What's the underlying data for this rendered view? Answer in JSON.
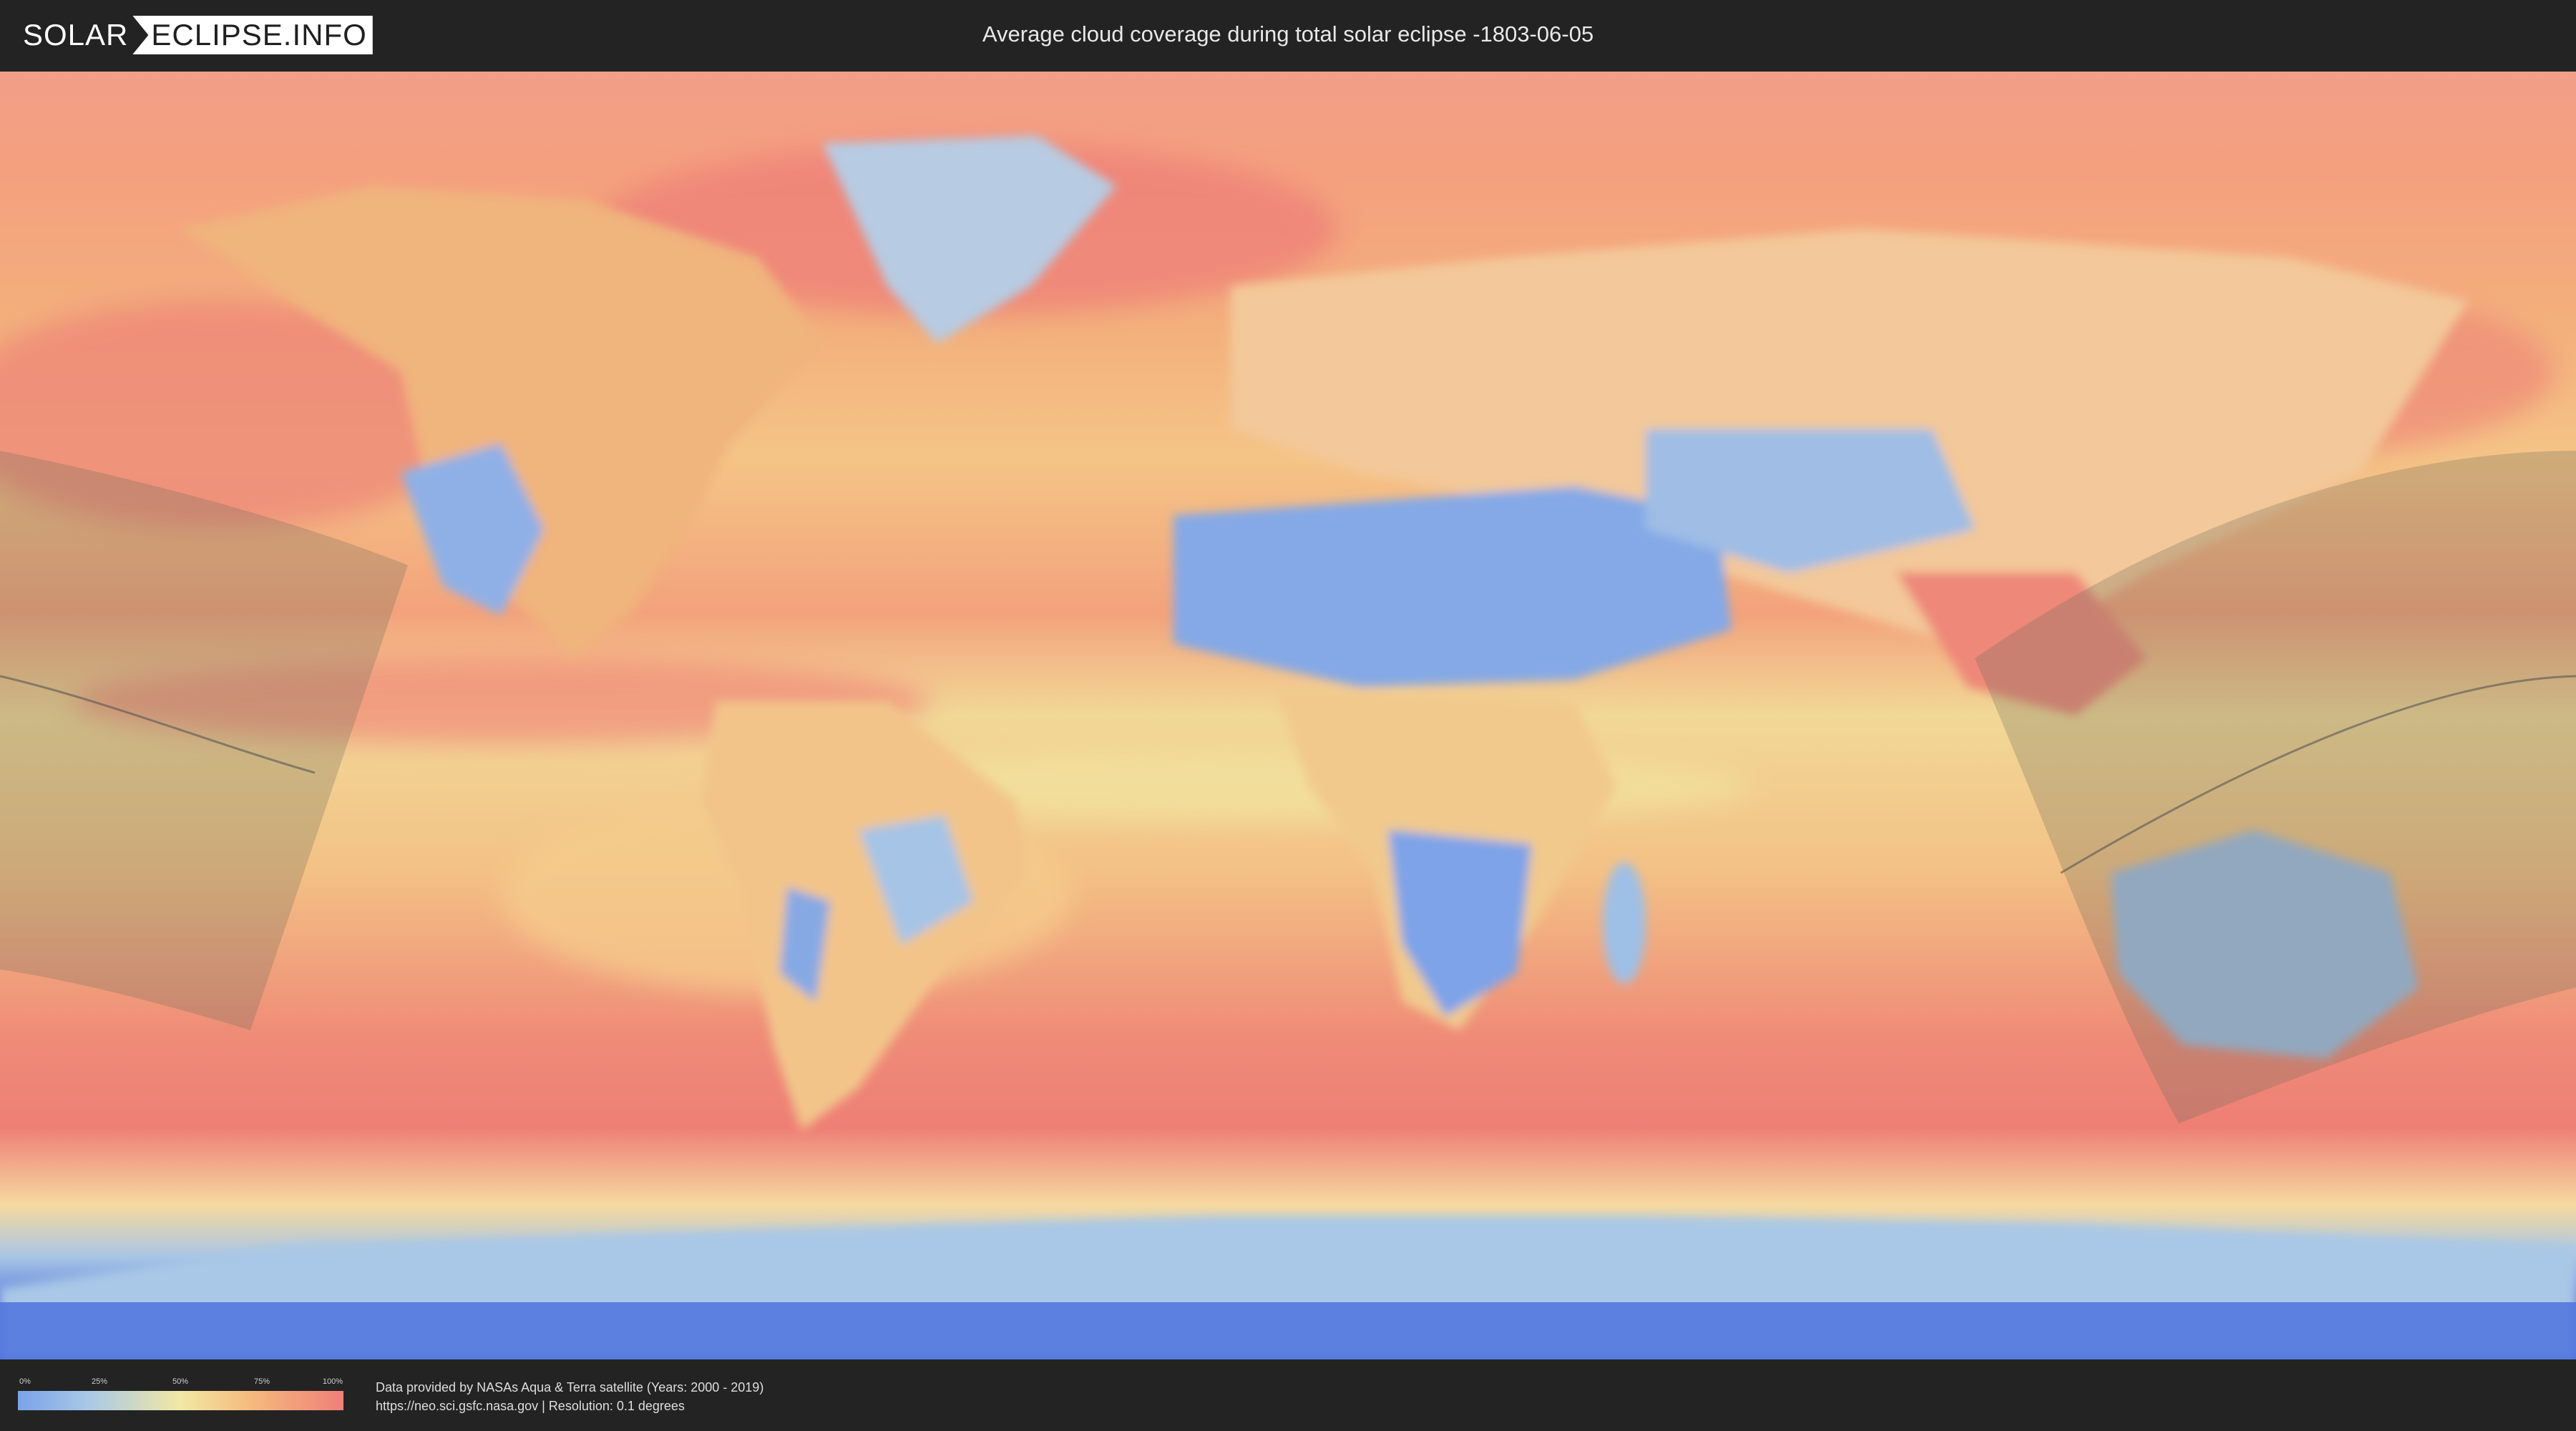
{
  "header": {
    "logo_left": "SOLAR",
    "logo_right": "ECLIPSE.INFO",
    "title": "Average cloud coverage during total solar eclipse -1803-06-05"
  },
  "legend": {
    "ticks": [
      "0%",
      "25%",
      "50%",
      "75%",
      "100%"
    ],
    "colors": [
      "#7aa2e8",
      "#a9c9e6",
      "#f2e8a4",
      "#f5b97c",
      "#ef7f7a"
    ]
  },
  "footer": {
    "line1": "Data provided by NASAs Aqua & Terra satellite (Years: 2000 - 2019)",
    "line2": "https://neo.sci.gsfc.nasa.gov | Resolution: 0.1 degrees"
  }
}
